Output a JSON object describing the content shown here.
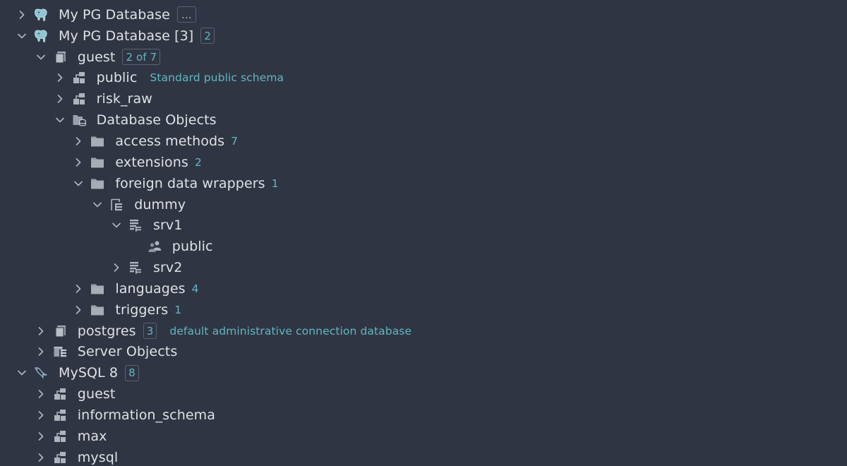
{
  "tree": [
    {
      "name": "My PG Database",
      "level": 0,
      "chevron": "right",
      "icon": "postgres-elephant-icon",
      "badge": "...",
      "badge_style": "dots"
    },
    {
      "name": "My PG Database [3]",
      "level": 0,
      "chevron": "down",
      "icon": "postgres-elephant-icon",
      "badge": "2"
    },
    {
      "name": "guest",
      "level": 1,
      "chevron": "down",
      "icon": "database-icon",
      "badge": "2 of 7"
    },
    {
      "name": "public",
      "level": 2,
      "chevron": "right",
      "icon": "schema-icon",
      "comment": "Standard public schema"
    },
    {
      "name": "risk_raw",
      "level": 2,
      "chevron": "right",
      "icon": "schema-icon"
    },
    {
      "name": "Database Objects",
      "level": 2,
      "chevron": "down",
      "icon": "database-objects-folder-icon"
    },
    {
      "name": "access methods",
      "level": 3,
      "chevron": "right",
      "icon": "folder-icon",
      "count": "7"
    },
    {
      "name": "extensions",
      "level": 3,
      "chevron": "right",
      "icon": "folder-icon",
      "count": "2"
    },
    {
      "name": "foreign data wrappers",
      "level": 3,
      "chevron": "down",
      "icon": "folder-icon",
      "count": "1"
    },
    {
      "name": "dummy",
      "level": 4,
      "chevron": "down",
      "icon": "foreign-data-wrapper-icon"
    },
    {
      "name": "srv1",
      "level": 5,
      "chevron": "down",
      "icon": "server-icon"
    },
    {
      "name": "public",
      "level": 6,
      "chevron": "none",
      "icon": "user-mapping-icon"
    },
    {
      "name": "srv2",
      "level": 5,
      "chevron": "right",
      "icon": "server-icon"
    },
    {
      "name": "languages",
      "level": 3,
      "chevron": "right",
      "icon": "folder-icon",
      "count": "4"
    },
    {
      "name": "triggers",
      "level": 3,
      "chevron": "right",
      "icon": "folder-icon",
      "count": "1"
    },
    {
      "name": "postgres",
      "level": 1,
      "chevron": "right",
      "icon": "database-icon",
      "badge": "3",
      "comment": "default administrative connection database"
    },
    {
      "name": "Server Objects",
      "level": 1,
      "chevron": "right",
      "icon": "server-objects-icon"
    },
    {
      "name": "MySQL 8",
      "level": 0,
      "chevron": "down",
      "icon": "mysql-dolphin-icon",
      "badge": "8"
    },
    {
      "name": "guest",
      "level": 1,
      "chevron": "right",
      "icon": "schema-icon"
    },
    {
      "name": "information_schema",
      "level": 1,
      "chevron": "right",
      "icon": "schema-icon"
    },
    {
      "name": "max",
      "level": 1,
      "chevron": "right",
      "icon": "schema-icon"
    },
    {
      "name": "mysql",
      "level": 1,
      "chevron": "right",
      "icon": "schema-icon"
    }
  ],
  "colors": {
    "background": "#303543",
    "text": "#dfe1e5",
    "accent": "#5fb7c2",
    "icon": "#8c929e"
  }
}
